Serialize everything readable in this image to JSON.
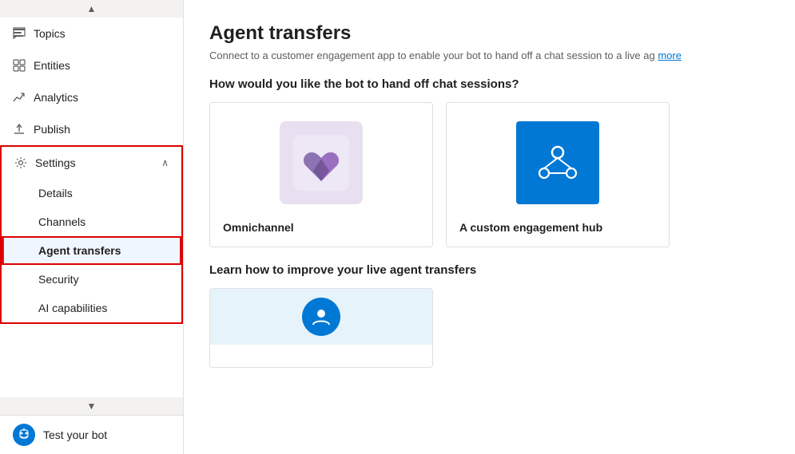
{
  "sidebar": {
    "items": [
      {
        "id": "topics",
        "label": "Topics",
        "icon": "chat"
      },
      {
        "id": "entities",
        "label": "Entities",
        "icon": "grid"
      },
      {
        "id": "analytics",
        "label": "Analytics",
        "icon": "trending-up"
      },
      {
        "id": "publish",
        "label": "Publish",
        "icon": "upload"
      }
    ],
    "settings": {
      "label": "Settings",
      "icon": "gear",
      "subItems": [
        {
          "id": "details",
          "label": "Details"
        },
        {
          "id": "channels",
          "label": "Channels"
        },
        {
          "id": "agent-transfers",
          "label": "Agent transfers",
          "active": true
        },
        {
          "id": "security",
          "label": "Security"
        },
        {
          "id": "ai-capabilities",
          "label": "AI capabilities"
        }
      ]
    },
    "testBot": {
      "label": "Test your bot",
      "icon": "bot"
    }
  },
  "main": {
    "title": "Agent transfers",
    "description": "Connect to a customer engagement app to enable your bot to hand off a chat session to a live ag",
    "description_link": "more",
    "section1_title": "How would you like the bot to hand off chat sessions?",
    "section2_title": "Learn how to improve your live agent transfers",
    "cards": [
      {
        "id": "omnichannel",
        "label": "Omnichannel"
      },
      {
        "id": "custom-hub",
        "label": "A custom engagement hub"
      }
    ]
  }
}
